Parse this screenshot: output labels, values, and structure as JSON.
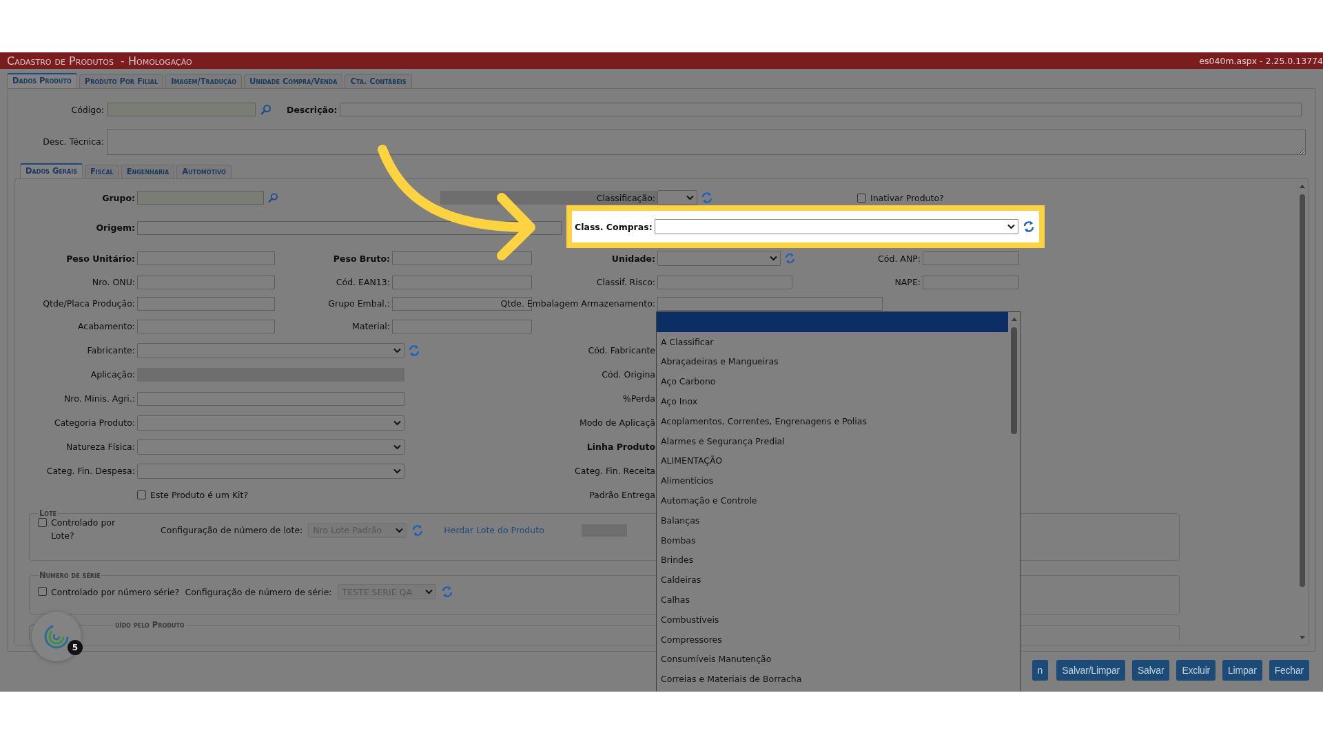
{
  "header": {
    "title": "Cadastro de Produtos",
    "environment": "- Homologação",
    "version": "es040m.aspx - 2.25.0.13774"
  },
  "tabs": [
    {
      "label": "Dados Produto",
      "selected": true
    },
    {
      "label": "Produto Por Filial",
      "selected": false
    },
    {
      "label": "Imagem/Tradução",
      "selected": false
    },
    {
      "label": "Unidade Compra/Venda",
      "selected": false
    },
    {
      "label": "Cta. Contábeis",
      "selected": false
    }
  ],
  "product": {
    "code_label": "Código:",
    "description_label": "Descrição:",
    "technical_label": "Desc. Técnica:"
  },
  "sub_tabs": [
    {
      "label": "Dados Gerais",
      "selected": true
    },
    {
      "label": "Fiscal",
      "selected": false
    },
    {
      "label": "Engenharia",
      "selected": false
    },
    {
      "label": "Automotivo",
      "selected": false
    }
  ],
  "rows": [
    {
      "left": {
        "label": "Grupo:",
        "bold": true,
        "kind": "lookup"
      },
      "middle": {
        "kind": "bar"
      },
      "right": {
        "label": "Classificação:",
        "kind": "mini_select",
        "refresh": true
      },
      "far_right": {
        "kind": "checkbox",
        "label": "Inativar Produto?",
        "checked": false
      }
    },
    {
      "left": {
        "label": "Origem:",
        "bold": true,
        "kind": "wide"
      }
    },
    {
      "left": {
        "label": "Peso Unitário:",
        "bold": true,
        "kind": "text"
      },
      "middle": {
        "label": "Peso Bruto:",
        "bold": true,
        "kind": "text"
      },
      "right": {
        "label": "Unidade:",
        "bold": true,
        "kind": "select",
        "refresh": true
      },
      "far_right": {
        "label": "Cód. ANP:",
        "kind": "text"
      }
    },
    {
      "left": {
        "label": "Nro. ONU:",
        "kind": "text"
      },
      "middle": {
        "label": "Cód. EAN13:",
        "kind": "text"
      },
      "right": {
        "label": "Classif. Risco:",
        "kind": "text"
      },
      "far_right": {
        "label": "NAPE:",
        "kind": "text"
      }
    },
    {
      "left": {
        "label": "Qtde/Placa Produção:",
        "kind": "text"
      },
      "middle": {
        "label": "Grupo Embal.:",
        "kind": "text"
      },
      "right": {
        "label": "Qtde. Embalagem Armazenamento:",
        "kind": "long"
      }
    },
    {
      "left": {
        "label": "Acabamento:",
        "kind": "text"
      },
      "middle": {
        "label": "Material:",
        "kind": "text"
      }
    },
    {
      "left": {
        "label": "Fabricante:",
        "kind": "select",
        "refresh": true
      },
      "right": {
        "label": "Cód. Fabricante",
        "kind": "label"
      }
    },
    {
      "left": {
        "label": "Aplicação:",
        "kind": "readonly"
      },
      "right": {
        "label": "Cód. Origina",
        "kind": "label"
      }
    },
    {
      "left": {
        "label": "Nro. Minis. Agri.:",
        "kind": "long"
      },
      "right": {
        "label": "%Perda",
        "kind": "label"
      }
    },
    {
      "left": {
        "label": "Categoria Produto:",
        "kind": "select"
      },
      "right": {
        "label": "Modo de Aplicaçã",
        "kind": "label"
      }
    },
    {
      "left": {
        "label": "Natureza Física:",
        "kind": "select"
      },
      "right": {
        "label": "Linha Produto",
        "bold": true,
        "kind": "label"
      }
    },
    {
      "left": {
        "label": "Categ. Fin. Despesa:",
        "kind": "select"
      },
      "right": {
        "label": "Categ. Fin. Receita",
        "kind": "label"
      }
    },
    {
      "left": {
        "kind": "checkbox",
        "label": "Este Produto é um Kit?",
        "checked": false
      },
      "right": {
        "label": "Padrão Entrega",
        "kind": "label"
      }
    }
  ],
  "lote": {
    "title": "Lote",
    "checkbox": {
      "label": "Controlado por Lote?",
      "checked": false
    },
    "config_label": "Configuração de número de lote:",
    "config_value": "Nro Lote Padrão",
    "link": "Herdar Lote do Produto"
  },
  "serie": {
    "title": "Numero de série",
    "checkbox": {
      "label": "Controlado por número série?",
      "checked": false
    },
    "config_label": "Configuração de número de série:",
    "config_value": "TESTE SERIE QA"
  },
  "third_section": {
    "title": "uído pelo Produto"
  },
  "buttons": [
    "n",
    "Salvar/Limpar",
    "Salvar",
    "Excluir",
    "Limpar",
    "Fechar"
  ],
  "highlight": {
    "label": "Class. Compras:"
  },
  "dropdown": {
    "options": [
      {
        "selected": true
      },
      {
        "label": "A Classificar",
        "selected": false
      },
      {
        "label": "Abraçadeiras e Mangueiras",
        "selected": false
      },
      {
        "label": "Aço Carbono",
        "selected": false
      },
      {
        "label": "Aço Inox",
        "selected": false
      },
      {
        "label": "Acoplamentos, Correntes, Engrenagens e Polias",
        "selected": false
      },
      {
        "label": "Alarmes e Segurança Predial",
        "selected": false
      },
      {
        "label": "ALIMENTAÇÃO",
        "selected": false
      },
      {
        "label": "Alimentícios",
        "selected": false
      },
      {
        "label": "Automação e Controle",
        "selected": false
      },
      {
        "label": "Balanças",
        "selected": false
      },
      {
        "label": "Bombas",
        "selected": false
      },
      {
        "label": "Brindes",
        "selected": false
      },
      {
        "label": "Caldeiras",
        "selected": false
      },
      {
        "label": "Calhas",
        "selected": false
      },
      {
        "label": "Combustíveis",
        "selected": false
      },
      {
        "label": "Compressores",
        "selected": false
      },
      {
        "label": "Consumíveis Manutenção",
        "selected": false
      },
      {
        "label": "Correias e Materiais de Borracha",
        "selected": false
      }
    ]
  },
  "help_widget": {
    "badge": "5"
  }
}
